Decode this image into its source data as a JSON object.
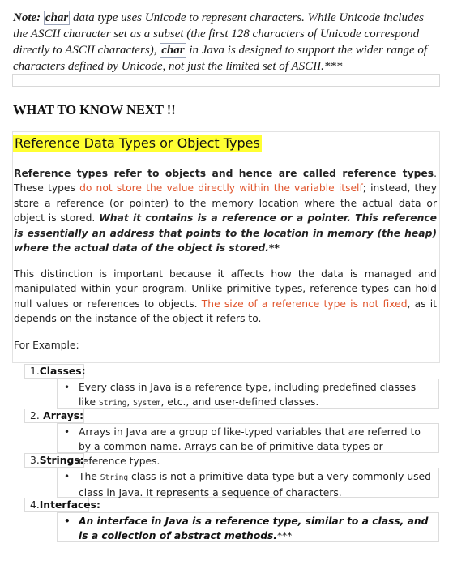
{
  "note": {
    "label": "Note:",
    "code1": "char",
    "text1": " data type uses Unicode to represent characters. While Unicode includes the ASCII character set as a subset (the first 128 characters of Unicode correspond directly to ASCII characters), ",
    "code2": "char",
    "text2": " in Java is designed to support the wider range of characters defined by Unicode, not just the limited set of ASCII.***"
  },
  "heading_next": "WHAT TO KNOW NEXT !!",
  "section_title": "Reference Data Types or Object Types",
  "p1": {
    "bold_lead": "Reference types refer to objects and hence are called reference types",
    "plain1": ". These types ",
    "red1": "do not store the value directly within the variable itself",
    "plain2": "; instead, they store a reference (or pointer) to the memory location where the actual data or object is stored. ",
    "bold_italic": "What it contains is a reference or a pointer. This reference is essentially an address that points to the location in memory (the heap) where the actual data of the object is stored.",
    "stars": "**"
  },
  "p2": {
    "plain1": " This distinction is important because it affects how the data is managed and manipulated within your program. Unlike primitive types, reference types can hold null values or references to objects. ",
    "red": "The size of a reference type is not fixed",
    "plain2": ", as it depends on the instance of the object it refers to."
  },
  "p3": "For Example:",
  "list": [
    {
      "num": "1.",
      "label": "Classes:",
      "sub_pre": "Every class in Java is a reference type, including predefined classes like ",
      "mono1": "String",
      "sub_mid": ", ",
      "mono2": "System",
      "sub_post": ", etc., and user-defined classes."
    },
    {
      "num": "2.",
      "label": "Arrays:",
      "sub": "Arrays in Java are a group of like-typed variables that are referred to by a common name. Arrays can be of primitive data types or reference types."
    },
    {
      "num": "3.",
      "label": "Strings:",
      "sub_pre": "The ",
      "mono1": "String",
      "sub_post": " class is not a primitive data type but a very commonly used class in Java. It represents a sequence of characters."
    },
    {
      "num": "4.",
      "label": "Interfaces:",
      "sub": "An interface in Java is a reference type, similar to a class, and is a collection of abstract methods.",
      "stars": "***"
    }
  ],
  "bullet": "•"
}
